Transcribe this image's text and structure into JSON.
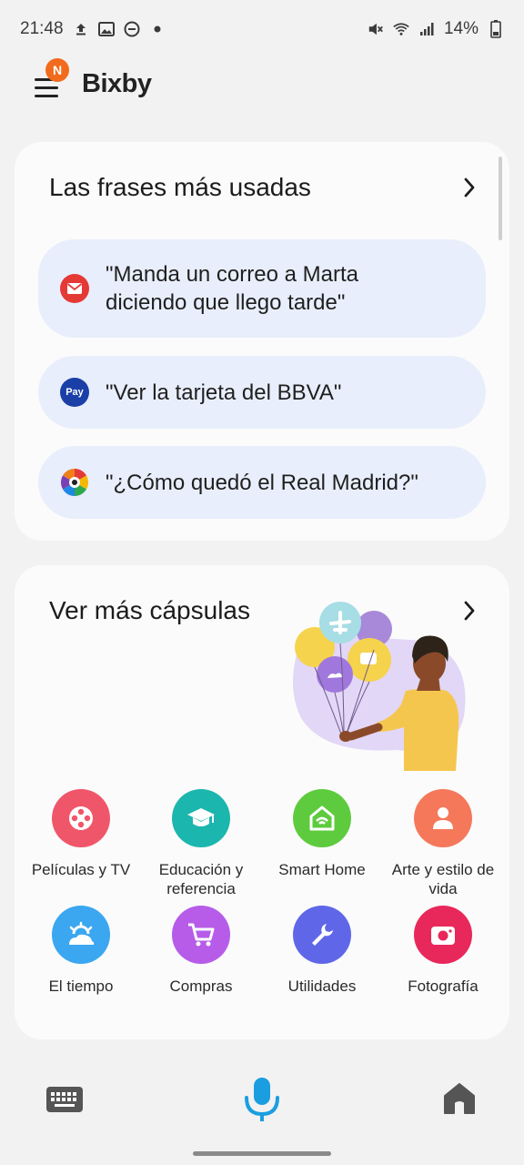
{
  "status_bar": {
    "time": "21:48",
    "battery": "14%",
    "icons_left": [
      "upload-icon",
      "image-icon",
      "dnd-icon",
      "dot-icon"
    ],
    "icons_right": [
      "mute-icon",
      "wifi-icon",
      "signal-icon",
      "battery-icon"
    ]
  },
  "header": {
    "title": "Bixby",
    "badge": "N"
  },
  "phrases_card": {
    "title": "Las frases más usadas",
    "items": [
      {
        "text_line1": "\"Manda un correo a Marta",
        "text_line2": "diciendo que llego tarde\"",
        "icon": "email-icon",
        "color": "#e53935"
      },
      {
        "text_line1": "\"Ver la tarjeta del BBVA\"",
        "icon": "pay-icon",
        "icon_text": "Pay",
        "color": "#1a3fa7"
      },
      {
        "text_line1": "\"¿Cómo quedó el Real Madrid?\"",
        "icon": "laliga-icon"
      }
    ]
  },
  "capsules_card": {
    "title": "Ver más cápsulas",
    "items": [
      {
        "label": "Películas y TV",
        "icon": "film-reel-icon",
        "color": "#f0566a"
      },
      {
        "label": "Educación y referencia",
        "icon": "graduation-cap-icon",
        "color": "#1bb6ad"
      },
      {
        "label": "Smart Home",
        "icon": "smart-home-icon",
        "color": "#5ecb3e"
      },
      {
        "label": "Arte y estilo de vida",
        "icon": "person-icon",
        "color": "#f5785a"
      },
      {
        "label": "El tiempo",
        "icon": "weather-icon",
        "color": "#3aa7f0"
      },
      {
        "label": "Compras",
        "icon": "cart-icon",
        "color": "#b65ce8"
      },
      {
        "label": "Utilidades",
        "icon": "wrench-icon",
        "color": "#5f67e8"
      },
      {
        "label": "Fotografía",
        "icon": "camera-icon",
        "color": "#e8285a"
      }
    ]
  },
  "bottom_bar": {
    "left_icon": "keyboard-icon",
    "center_icon": "microphone-icon",
    "right_icon": "home-icon",
    "accent": "#1b9ee0"
  }
}
